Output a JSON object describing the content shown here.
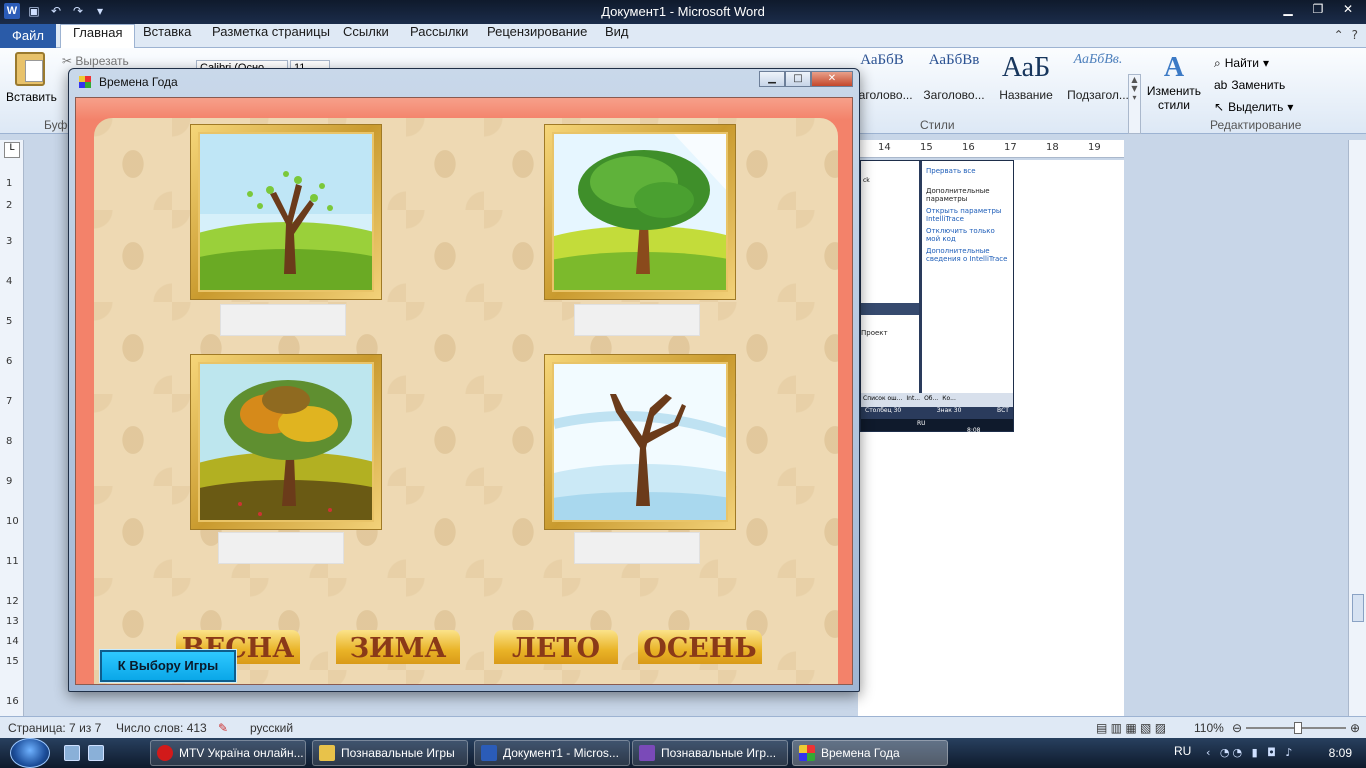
{
  "word": {
    "title": "Документ1 - Microsoft Word",
    "logo": "W",
    "file_tab": "Файл",
    "tabs": [
      "Главная",
      "Вставка",
      "Разметка страницы",
      "Ссылки",
      "Рассылки",
      "Рецензирование",
      "Вид"
    ],
    "paste_label": "Вставить",
    "cut_label": "Вырезать",
    "clipboard_group": "Буфер обмена",
    "font_name": "Calibri (Осно",
    "font_size": "11",
    "styles": [
      {
        "sample": "АаБбВ",
        "name": "Заголово..."
      },
      {
        "sample": "АаБбВв",
        "name": "Заголово..."
      },
      {
        "sample": "АаБ",
        "name": "Название"
      },
      {
        "sample": "АаБбВв.",
        "name": "Подзагол..."
      }
    ],
    "change_styles_line1": "Изменить",
    "change_styles_line2": "стили",
    "styles_group": "Стили",
    "find": "Найти",
    "replace": "Заменить",
    "select": "Выделить",
    "editing_group": "Редактирование",
    "ruler_numbers": [
      "14",
      "15",
      "16",
      "17",
      "18",
      "19"
    ],
    "ruler_v_numbers": [
      "1",
      "2",
      "3",
      "4",
      "5",
      "6",
      "7",
      "8",
      "9",
      "10",
      "11",
      "12",
      "13",
      "14",
      "15",
      "16"
    ],
    "status": {
      "page": "Страница: 7 из 7",
      "words": "Число слов: 413",
      "language": "русский",
      "zoom": "110%"
    }
  },
  "embedded": {
    "break_all": "Прервать все",
    "header": "Дополнительные параметры",
    "link1": "Открыть параметры IntelliTrace",
    "link2": "Отключить только мой код",
    "link3": "Дополнительные сведения о IntelliTrace",
    "project": "Проект",
    "errors_tab": "Список ош...",
    "tab_int": "Int...",
    "tab_ob": "Об...",
    "tab_ko": "Ко...",
    "status_col": "Столбец 30",
    "status_char": "Знак 30",
    "status_ins": "ВСТ",
    "mini_lang": "RU",
    "mini_clock": "8:08",
    "side_word": "ck"
  },
  "game": {
    "window_title": "Времена Года",
    "season_buttons": [
      "ВЕСНА",
      "ЗИМА",
      "ЛЕТО",
      "ОСЕНЬ"
    ],
    "back_button": "К Выбору Игры",
    "pictures": [
      "spring-tree",
      "summer-tree",
      "autumn-tree",
      "winter-tree"
    ],
    "colors": {
      "background": "#f3826a",
      "button_gold": "#e9b327",
      "back_button": "#0aa7e8"
    }
  },
  "taskbar": {
    "items": [
      {
        "label": "MTV Україна онлайн...",
        "icon": "opera-icon"
      },
      {
        "label": "Познавальные Игры",
        "icon": "folder-icon"
      },
      {
        "label": "Документ1 - Micros...",
        "icon": "word-icon"
      },
      {
        "label": "Познавальные Игр...",
        "icon": "visual-studio-icon"
      },
      {
        "label": "Времена Года",
        "icon": "app-icon"
      }
    ],
    "lang": "RU",
    "clock": "8:09"
  }
}
